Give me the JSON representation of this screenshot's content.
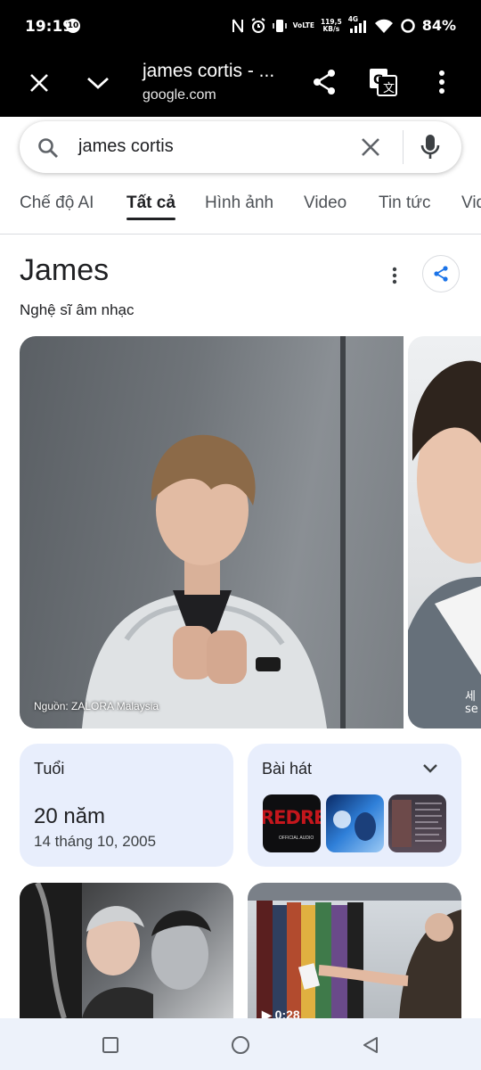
{
  "status_bar": {
    "time": "19:19",
    "notification_badge": "10",
    "net_type": "VoLTE",
    "speed_value": "119,5",
    "speed_unit": "KB/s",
    "signal_label": "4G",
    "battery": "84%"
  },
  "toolbar": {
    "page_title": "james cortis - ...",
    "page_url": "google.com",
    "close_icon": "close-icon",
    "chevron_icon": "chevron-down-icon",
    "share_icon": "share-icon",
    "translate_icon": "translate-icon",
    "more_icon": "more-vert-icon"
  },
  "search": {
    "query": "james cortis"
  },
  "tabs": [
    {
      "label": "Chế độ AI"
    },
    {
      "label": "Tất cả",
      "active": true
    },
    {
      "label": "Hình ảnh"
    },
    {
      "label": "Video"
    },
    {
      "label": "Tin tức"
    },
    {
      "label": "Vid"
    }
  ],
  "knowledge_panel": {
    "name": "James",
    "subtitle": "Nghệ sĩ âm nhạc",
    "image_credit": "Nguồn: ZALORA Malaysia",
    "side_image_caption": "세\nse"
  },
  "cards": {
    "age": {
      "label": "Tuổi",
      "value": "20 năm",
      "birthdate": "14 tháng 10, 2005"
    },
    "songs": {
      "label": "Bài hát",
      "thumb1_text": "REDRE",
      "thumb1_caption": "OFFICIAL AUDIO"
    }
  },
  "video_tile": {
    "duration_partial": "0:28"
  },
  "colors": {
    "accent_blue": "#1a73e8",
    "card_bg": "#e8eefc",
    "status_bg": "#000000",
    "nav_bg": "#edf2fa"
  }
}
